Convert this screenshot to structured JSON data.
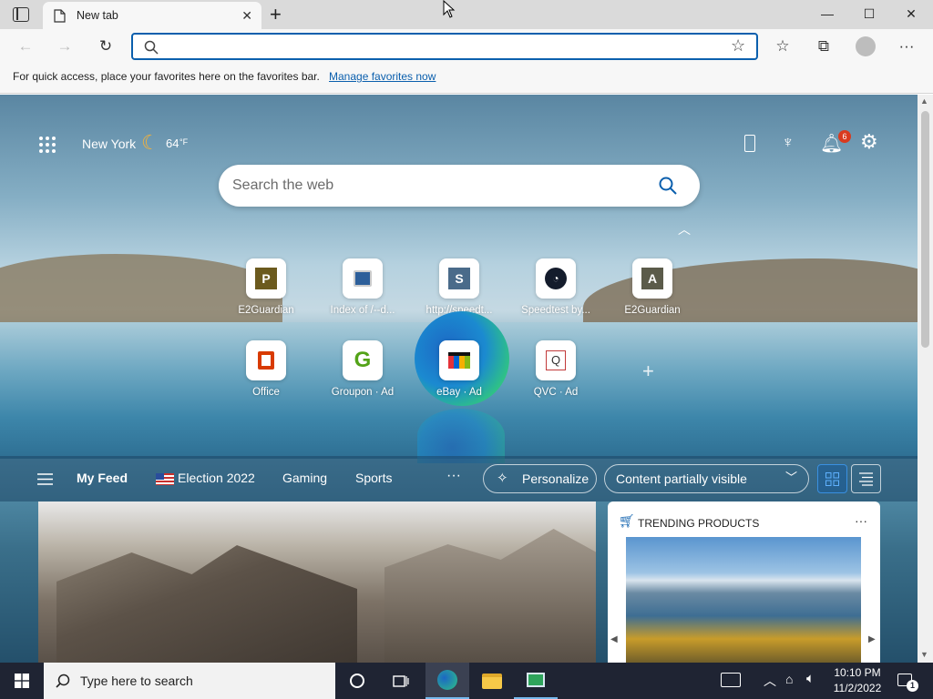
{
  "tab": {
    "title": "New tab"
  },
  "window": {
    "minimize": "—",
    "maximize": "☐",
    "close": "✕"
  },
  "address_bar": {
    "value": "",
    "placeholder": ""
  },
  "favorites_bar": {
    "message": "For quick access, place your favorites here on the favorites bar.",
    "link": "Manage favorites now"
  },
  "weather": {
    "city": "New York",
    "temp": "64",
    "unit": "°F"
  },
  "notifications": {
    "count": "6"
  },
  "search": {
    "placeholder": "Search the web"
  },
  "quick_links": [
    {
      "label": "E2Guardian",
      "letter": "P",
      "color": "#6b5a1e"
    },
    {
      "label": "Index of /--d...",
      "letter": "",
      "color": "#2d5f9a"
    },
    {
      "label": "http://speedt...",
      "letter": "S",
      "color": "#4a6b8a"
    },
    {
      "label": "Speedtest by...",
      "letter": "",
      "color": "#141c2c"
    },
    {
      "label": "E2Guardian",
      "letter": "A",
      "color": "#5b5b4a"
    },
    {
      "label": "Office",
      "letter": "",
      "color": "#d83b01"
    },
    {
      "label": "Groupon · Ad",
      "letter": "G",
      "color": "#53a318"
    },
    {
      "label": "eBay · Ad",
      "letter": "",
      "color": "#e53238"
    },
    {
      "label": "QVC · Ad",
      "letter": "Q",
      "color": "#c23a3a"
    }
  ],
  "feed": {
    "items": [
      "My Feed",
      "Election 2022",
      "Gaming",
      "Sports"
    ],
    "more": "···",
    "personalize": "Personalize",
    "visibility": "Content partially visible"
  },
  "trending": {
    "title": "TRENDING PRODUCTS",
    "more": "···"
  },
  "taskbar": {
    "search_placeholder": "Type here to search",
    "time": "10:10 PM",
    "date": "11/2/2022",
    "notification_count": "1"
  },
  "colors": {
    "accent": "#0b5fad",
    "notification_badge": "#d93a1e"
  }
}
